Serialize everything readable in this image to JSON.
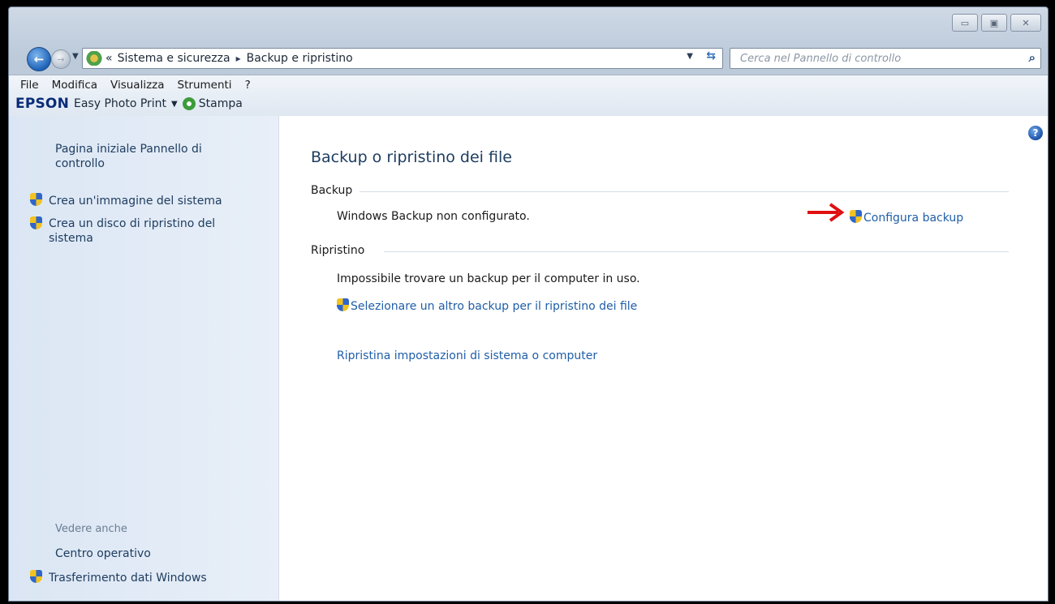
{
  "address_bar": {
    "back_icon": "back-arrow-icon",
    "forward_icon": "forward-arrow-icon",
    "separator": "«",
    "crumbs": [
      "Sistema e sicurezza",
      "Backup e ripristino"
    ],
    "crumb_separator": "▸"
  },
  "search": {
    "placeholder": "Cerca nel Pannello di controllo",
    "value": ""
  },
  "menu": {
    "items": [
      "File",
      "Modifica",
      "Visualizza",
      "Strumenti",
      "?"
    ]
  },
  "toolbar": {
    "brand": "EPSON",
    "app_label": "Easy Photo Print",
    "print_label": "Stampa"
  },
  "sidebar": {
    "home_link": "Pagina iniziale Pannello di controllo",
    "links": [
      "Crea un'immagine del sistema",
      "Crea un disco di ripristino del sistema"
    ],
    "see_also_label": "Vedere anche",
    "see_also_links": [
      "Centro operativo",
      "Trasferimento dati Windows"
    ]
  },
  "main": {
    "title": "Backup o ripristino dei file",
    "backup_section": "Backup",
    "backup_status": "Windows Backup non configurato.",
    "configure_link": "Configura backup",
    "restore_section": "Ripristino",
    "restore_status": "Impossibile trovare un backup per il computer in uso.",
    "select_backup_link": "Selezionare un altro backup per il ripristino dei file",
    "restore_settings_link": "Ripristina impostazioni di sistema o computer"
  },
  "colors": {
    "link": "#1f5ea8",
    "title": "#1e3d60",
    "arrow": "#e01010"
  }
}
